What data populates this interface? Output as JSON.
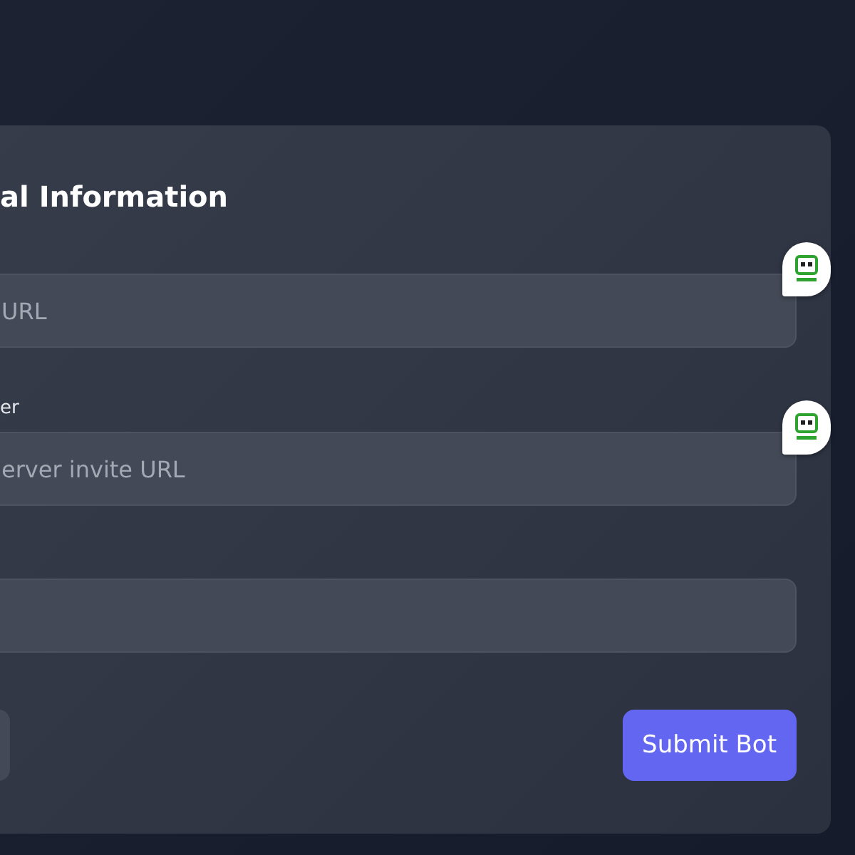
{
  "card": {
    "title": "al Information",
    "fields": [
      {
        "placeholder": "URL",
        "badge": true
      },
      {
        "label": "er",
        "placeholder": "erver invite URL",
        "badge": true
      },
      {
        "badge": false
      }
    ],
    "buttons": [
      {
        "kind": "secondary"
      },
      {
        "kind": "primary",
        "label": "Submit Bot"
      }
    ]
  }
}
